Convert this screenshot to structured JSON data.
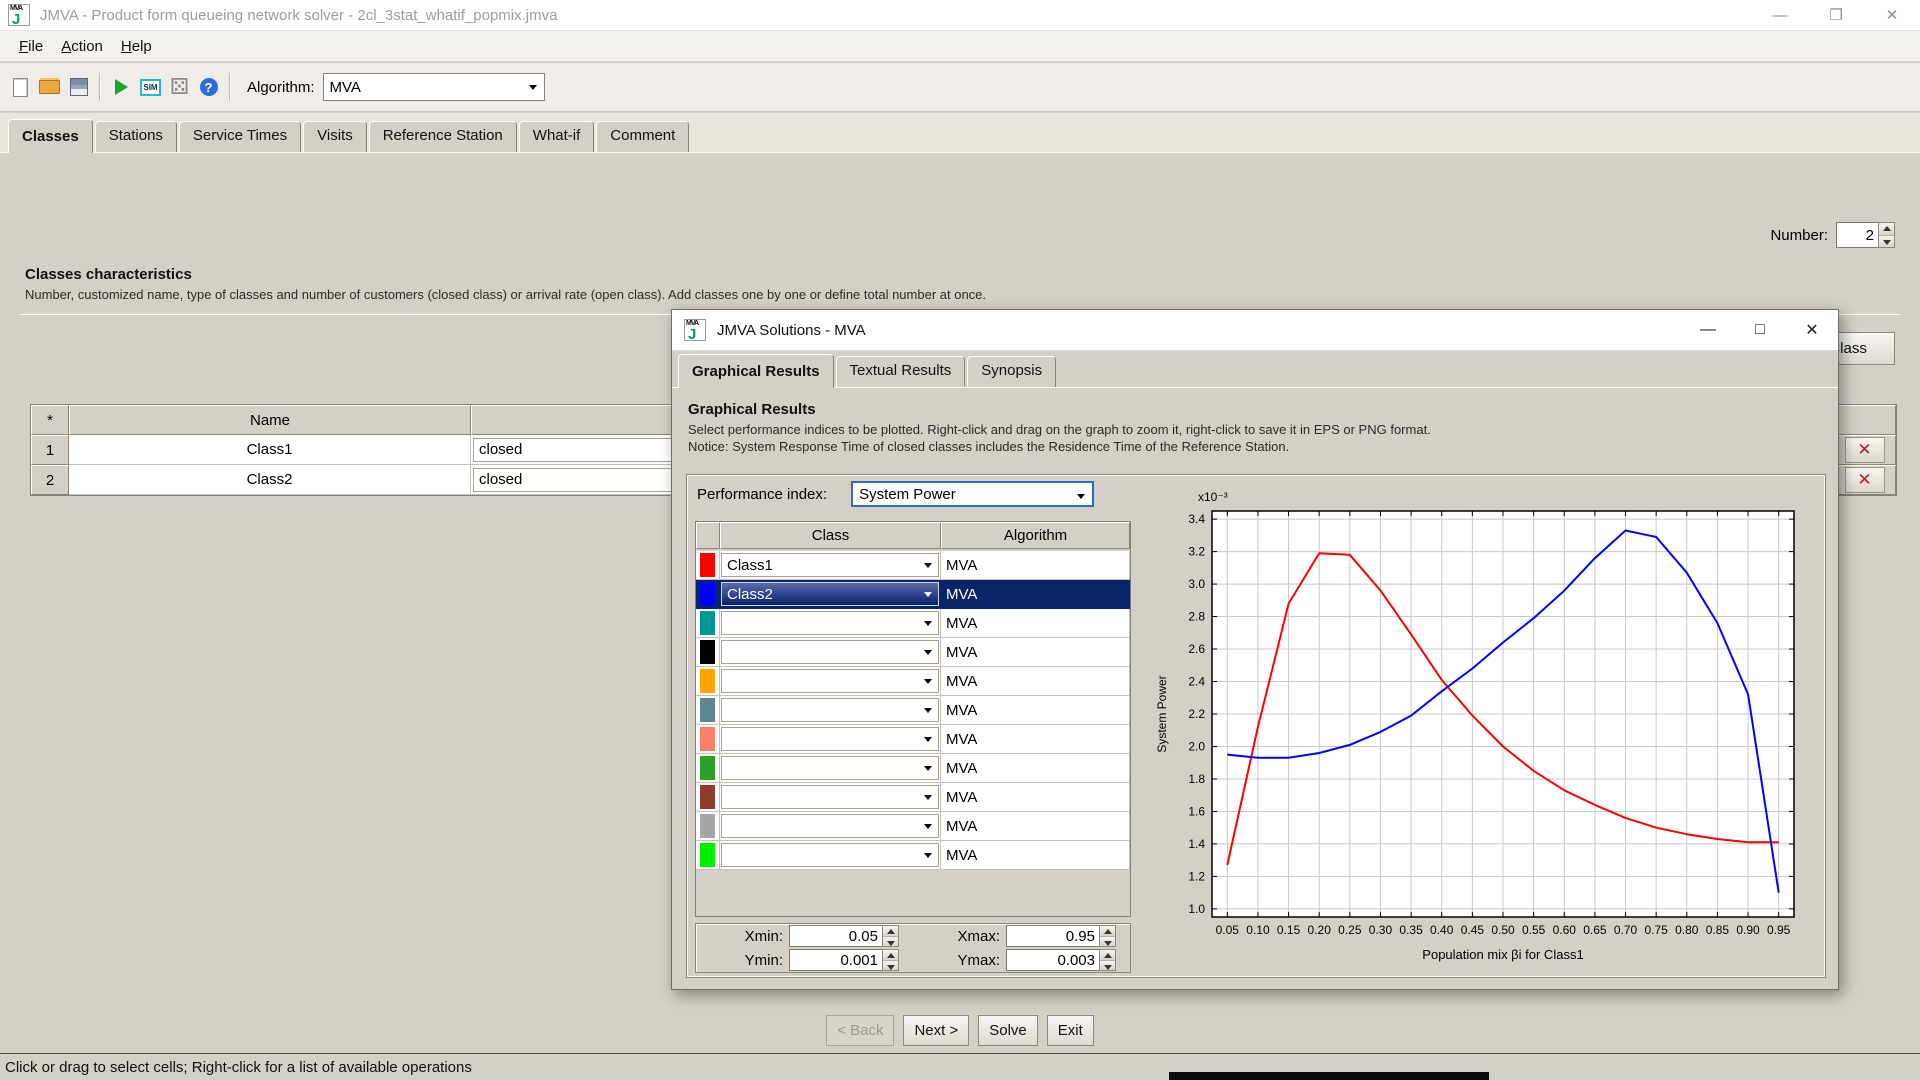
{
  "window": {
    "title": "JMVA - Product form queueing network solver - 2cl_3stat_whatif_popmix.jmva",
    "controls": [
      {
        "name": "minimize-button",
        "glyph": "—"
      },
      {
        "name": "restore-button",
        "glyph": "❐"
      },
      {
        "name": "close-button",
        "glyph": "✕"
      }
    ]
  },
  "menu": {
    "items": [
      "File",
      "Action",
      "Help"
    ]
  },
  "toolbar": {
    "icons": [
      "new-document-icon",
      "open-folder-icon",
      "save-icon",
      "|",
      "run-icon",
      "sim-icon",
      "random-icon",
      "help-icon",
      "|"
    ],
    "algorithm_label": "Algorithm:",
    "algorithm_value": "MVA"
  },
  "main_tabs": {
    "items": [
      "Classes",
      "Stations",
      "Service Times",
      "Visits",
      "Reference Station",
      "What-if",
      "Comment"
    ],
    "selected": 0
  },
  "classes_panel": {
    "number_label": "Number:",
    "number_value": "2",
    "heading": "Classes characteristics",
    "description": "Number, customized name, type of classes and number of customers (closed class) or arrival rate (open class). Add classes one by one or define total number at once.",
    "new_class_button": "New Class",
    "table": {
      "headers": [
        "*",
        "Name",
        "",
        ""
      ],
      "delete_glyph": "✕",
      "rows": [
        {
          "index": "1",
          "name": "Class1",
          "type": "closed"
        },
        {
          "index": "2",
          "name": "Class2",
          "type": "closed"
        }
      ]
    }
  },
  "nav_buttons": [
    {
      "name": "back-button",
      "label": "< Back",
      "disabled": true
    },
    {
      "name": "next-button",
      "label": "Next >",
      "disabled": false
    },
    {
      "name": "solve-button",
      "label": "Solve",
      "disabled": false
    },
    {
      "name": "exit-button",
      "label": "Exit",
      "disabled": false
    }
  ],
  "status_bar": "Click or drag to select cells; Right-click for a list of available operations",
  "dialog": {
    "title": "JMVA Solutions - MVA",
    "controls": [
      {
        "name": "dialog-minimize-button",
        "glyph": "—"
      },
      {
        "name": "dialog-maximize-button",
        "glyph": "□"
      },
      {
        "name": "dialog-close-button",
        "glyph": "✕"
      }
    ],
    "tabs": {
      "items": [
        "Graphical Results",
        "Textual Results",
        "Synopsis"
      ],
      "selected": 0
    },
    "heading": "Graphical Results",
    "description_line1": "Select performance indices to be plotted. Right-click and drag on the graph to zoom it, right-click to save it in EPS or PNG format.",
    "description_line2": "Notice: System Response Time of closed classes includes the Residence Time of the Reference Station.",
    "performance_index_label": "Performance index:",
    "performance_index_value": "System Power",
    "plot_table": {
      "headers": [
        "",
        "Class",
        "Algorithm"
      ],
      "rows": [
        {
          "color": "#ff0000",
          "class": "Class1",
          "algorithm": "MVA",
          "selected": false
        },
        {
          "color": "#0000ff",
          "class": "Class2",
          "algorithm": "MVA",
          "selected": true
        },
        {
          "color": "#009696",
          "class": "",
          "algorithm": "MVA",
          "selected": false
        },
        {
          "color": "#000000",
          "class": "",
          "algorithm": "MVA",
          "selected": false
        },
        {
          "color": "#ffa400",
          "class": "",
          "algorithm": "MVA",
          "selected": false
        },
        {
          "color": "#5d8593",
          "class": "",
          "algorithm": "MVA",
          "selected": false
        },
        {
          "color": "#fa8167",
          "class": "",
          "algorithm": "MVA",
          "selected": false
        },
        {
          "color": "#2ea12b",
          "class": "",
          "algorithm": "MVA",
          "selected": false
        },
        {
          "color": "#8d3c2c",
          "class": "",
          "algorithm": "MVA",
          "selected": false
        },
        {
          "color": "#a5a5a5",
          "class": "",
          "algorithm": "MVA",
          "selected": false
        },
        {
          "color": "#00ee00",
          "class": "",
          "algorithm": "MVA",
          "selected": false
        }
      ]
    },
    "range_fields": [
      {
        "name": "xmin",
        "label": "Xmin:",
        "value": "0.05"
      },
      {
        "name": "xmax",
        "label": "Xmax:",
        "value": "0.95"
      },
      {
        "name": "ymin",
        "label": "Ymin:",
        "value": "0.001"
      },
      {
        "name": "ymax",
        "label": "Ymax:",
        "value": "0.003"
      }
    ]
  },
  "chart_data": {
    "type": "line",
    "title": "",
    "y_scale_label": "x10⁻³",
    "ylabel": "System Power",
    "xlabel": "Population mix βi for Class1",
    "grid": true,
    "legend": "none",
    "xlim": [
      0.025,
      0.975
    ],
    "ylim": [
      0.95,
      3.45
    ],
    "x": [
      0.05,
      0.1,
      0.15,
      0.2,
      0.25,
      0.3,
      0.35,
      0.4,
      0.45,
      0.5,
      0.55,
      0.6,
      0.65,
      0.7,
      0.75,
      0.8,
      0.85,
      0.9,
      0.95
    ],
    "x_ticks": [
      0.05,
      0.1,
      0.15,
      0.2,
      0.25,
      0.3,
      0.35,
      0.4,
      0.45,
      0.5,
      0.55,
      0.6,
      0.65,
      0.7,
      0.75,
      0.8,
      0.85,
      0.9,
      0.95
    ],
    "y_ticks": [
      1.0,
      1.2,
      1.4,
      1.6,
      1.8,
      2.0,
      2.2,
      2.4,
      2.6,
      2.8,
      3.0,
      3.2,
      3.4
    ],
    "series": [
      {
        "name": "Class1",
        "color": "#ff0000",
        "values": [
          1.27,
          2.12,
          2.88,
          3.19,
          3.18,
          2.96,
          2.69,
          2.41,
          2.19,
          2.0,
          1.85,
          1.73,
          1.64,
          1.56,
          1.5,
          1.46,
          1.43,
          1.41,
          1.41
        ]
      },
      {
        "name": "Class2",
        "color": "#0000ff",
        "values": [
          1.95,
          1.93,
          1.93,
          1.96,
          2.01,
          2.09,
          2.19,
          2.34,
          2.48,
          2.64,
          2.79,
          2.96,
          3.16,
          3.33,
          3.29,
          3.07,
          2.76,
          2.32,
          1.1
        ]
      }
    ]
  },
  "colors": {
    "selection": "#0a246a",
    "window_bg": "#d4d0c8",
    "grid_line": "#c8c8c8"
  }
}
